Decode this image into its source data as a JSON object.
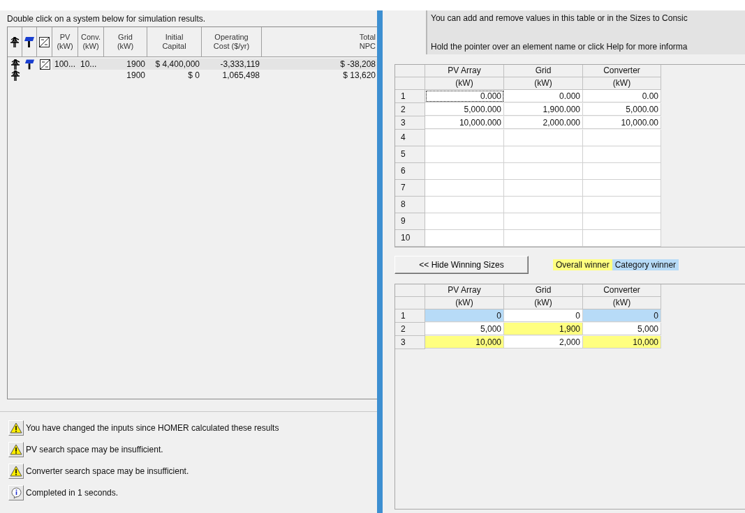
{
  "results": {
    "instruction": "Double click on a system below for simulation results.",
    "columns": [
      {
        "lines": [
          "PV",
          "(kW)"
        ]
      },
      {
        "lines": [
          "Conv.",
          "(kW)"
        ]
      },
      {
        "lines": [
          "Grid",
          "(kW)"
        ]
      },
      {
        "lines": [
          "Initial",
          "Capital"
        ]
      },
      {
        "lines": [
          "Operating",
          "Cost ($/yr)"
        ]
      },
      {
        "lines": [
          "Total",
          "NPC"
        ]
      }
    ],
    "rows": [
      {
        "selected": true,
        "grid": true,
        "pv": true,
        "converter": true,
        "values": {
          "pv": "100...",
          "conv": "10...",
          "grid": "1900",
          "initial_capital": "$ 4,400,000",
          "operating_cost": "-3,333,119",
          "total_npc": "$ -38,208"
        }
      },
      {
        "selected": false,
        "grid": true,
        "pv": false,
        "converter": false,
        "values": {
          "grid": "1900",
          "initial_capital": "$ 0",
          "operating_cost": "1,065,498",
          "total_npc": "$ 13,620"
        }
      }
    ]
  },
  "messages": [
    {
      "kind": "warning",
      "text": "You have changed the inputs since HOMER calculated these results"
    },
    {
      "kind": "warning",
      "text": "PV search space may be insufficient."
    },
    {
      "kind": "warning",
      "text": "Converter search space may be insufficient."
    },
    {
      "kind": "info",
      "text": "Completed in 1 seconds."
    }
  ],
  "info": [
    "You can add and remove values in this table or in the Sizes to Consic",
    "Hold the pointer over an element name or click Help for more informa"
  ],
  "sizes_table": {
    "columns": [
      {
        "name": "PV Array",
        "unit": "(kW)"
      },
      {
        "name": "Grid",
        "unit": "(kW)"
      },
      {
        "name": "Converter",
        "unit": "(kW)"
      }
    ],
    "rows": [
      {
        "number": "1",
        "values": [
          {
            "text": "0.000",
            "focused": true
          },
          {
            "text": "0.000",
            "focused": false
          },
          {
            "text": "0.00",
            "focused": false
          }
        ]
      },
      {
        "number": "2",
        "values": [
          {
            "text": "5,000.000",
            "focused": false
          },
          {
            "text": "1,900.000",
            "focused": false
          },
          {
            "text": "5,000.00",
            "focused": false
          }
        ]
      },
      {
        "number": "3",
        "values": [
          {
            "text": "10,000.000",
            "focused": false
          },
          {
            "text": "2,000.000",
            "focused": false
          },
          {
            "text": "10,000.00",
            "focused": false
          }
        ]
      },
      {
        "number": "4"
      },
      {
        "number": "5"
      },
      {
        "number": "6"
      },
      {
        "number": "7"
      },
      {
        "number": "8"
      },
      {
        "number": "9"
      },
      {
        "number": "10"
      }
    ]
  },
  "hide_button": "<< Hide Winning Sizes",
  "legend": [
    {
      "label": "Overall winner",
      "color": "#ffff80"
    },
    {
      "label": "Category winner",
      "color": "#b7dbf7"
    }
  ],
  "winning_table": {
    "columns": [
      {
        "name": "PV Array",
        "unit": "(kW)"
      },
      {
        "name": "Grid",
        "unit": "(kW)"
      },
      {
        "name": "Converter",
        "unit": "(kW)"
      }
    ],
    "rows": [
      {
        "number": "1",
        "values": [
          {
            "text": "0",
            "color": "#b7dbf7"
          },
          {
            "text": "0",
            "color": "#ffffff"
          },
          {
            "text": "0",
            "color": "#b7dbf7"
          }
        ]
      },
      {
        "number": "2",
        "values": [
          {
            "text": "5,000",
            "color": "#ffffff"
          },
          {
            "text": "1,900",
            "color": "#ffff80"
          },
          {
            "text": "5,000",
            "color": "#ffffff"
          }
        ]
      },
      {
        "number": "3",
        "values": [
          {
            "text": "10,000",
            "color": "#ffff80"
          },
          {
            "text": "2,000",
            "color": "#ffffff"
          },
          {
            "text": "10,000",
            "color": "#ffff80"
          }
        ]
      }
    ]
  }
}
